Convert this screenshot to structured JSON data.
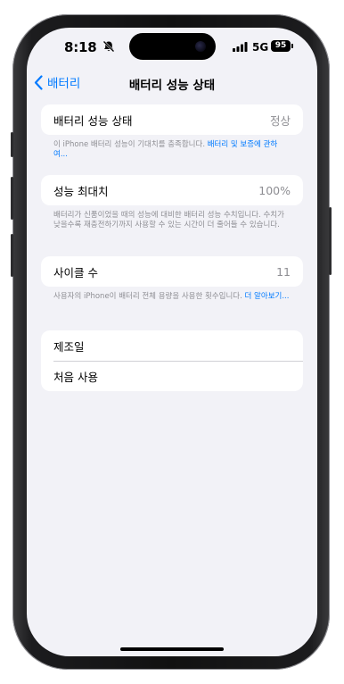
{
  "status_bar": {
    "time": "8:18",
    "network": "5G",
    "battery": "95",
    "icons": [
      "bell-slash-icon",
      "signal-icon",
      "battery-icon"
    ]
  },
  "nav": {
    "back_label": "배터리",
    "title": "배터리 성능 상태",
    "icons": [
      "chevron-left-icon"
    ]
  },
  "sections": {
    "health": {
      "label": "배터리 성능 상태",
      "value": "정상",
      "footer_text": "이 iPhone 배터리 성능이 기대치를 충족합니다. ",
      "footer_link": "배터리 및 보증에 관하여..."
    },
    "max_capacity": {
      "label": "성능 최대치",
      "value": "100%",
      "footer_text": "배터리가 신품이었을 때의 성능에 대비한 배터리 성능 수치입니다. 수치가 낮을수록 재충전하기까지 사용할 수 있는 시간이 더 줄어들 수 있습니다."
    },
    "cycle": {
      "label": "사이클 수",
      "value": "11",
      "footer_text": "사용자의 iPhone이 배터리 전체 용량을 사용한 횟수입니다. ",
      "footer_link": "더 알아보기..."
    },
    "info": {
      "manufacture_label": "제조일",
      "first_use_label": "처음 사용"
    }
  },
  "colors": {
    "accent": "#007aff",
    "background": "#f2f2f7",
    "secondary_text": "#8e8e93"
  }
}
